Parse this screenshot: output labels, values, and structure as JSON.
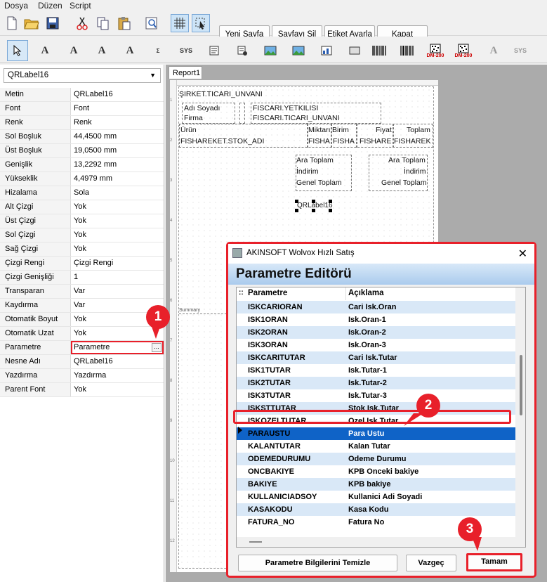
{
  "menu": [
    "Dosya",
    "Düzen",
    "Script"
  ],
  "toolbar": {
    "new_page": "Yeni Sayfa",
    "delete_page": "Sayfayı Sil",
    "label_settings": "Etiket Ayarla",
    "close": "Kapat"
  },
  "tools": {
    "sys1": "SYS",
    "dm1": "DM-200",
    "dm2": "DM-200",
    "sys2": "SYS"
  },
  "component_select": "QRLabel16",
  "properties": [
    {
      "k": "Metin",
      "v": "QRLabel16"
    },
    {
      "k": "Font",
      "v": "Font"
    },
    {
      "k": "Renk",
      "v": "Renk"
    },
    {
      "k": "Sol Boşluk",
      "v": "44,4500 mm"
    },
    {
      "k": "Üst Boşluk",
      "v": "19,0500 mm"
    },
    {
      "k": "Genişlik",
      "v": "13,2292 mm"
    },
    {
      "k": "Yükseklik",
      "v": "4,4979 mm"
    },
    {
      "k": "Hizalama",
      "v": "Sola"
    },
    {
      "k": "Alt Çizgi",
      "v": "Yok"
    },
    {
      "k": "Üst Çizgi",
      "v": "Yok"
    },
    {
      "k": "Sol Çizgi",
      "v": "Yok"
    },
    {
      "k": "Sağ Çizgi",
      "v": "Yok"
    },
    {
      "k": "Çizgi Rengi",
      "v": "Çizgi Rengi"
    },
    {
      "k": "Çizgi Genişliği",
      "v": "1"
    },
    {
      "k": "Transparan",
      "v": "Var"
    },
    {
      "k": "Kaydırma",
      "v": "Var"
    },
    {
      "k": "Otomatik Boyut",
      "v": "Yok"
    },
    {
      "k": "Otomatik Uzat",
      "v": "Yok"
    },
    {
      "k": "Parametre",
      "v": "Parametre"
    },
    {
      "k": "Nesne Adı",
      "v": "QRLabel16"
    },
    {
      "k": "Yazdırma",
      "v": "Yazdırma"
    },
    {
      "k": "Parent Font",
      "v": "Yok"
    }
  ],
  "report": {
    "tab": "Report1",
    "company": "ŞIRKET.TICARI_UNVANI",
    "adi_soyadi": "Adı Soyadı",
    "firma": "Firma",
    "yetkili": "FISCARI.YETKILISI",
    "unvan": "FISCARI.TICARI_UNVANI",
    "col_urun": "Ürün",
    "col_miktar": "Miktarı",
    "col_birim": "Birim",
    "col_fiyat": "Fiyat",
    "col_toplam": "Toplam",
    "d_stok": "FISHAREKET.STOK_ADI",
    "d_miktar": "FISHA",
    "d_birim": "FISHA",
    "d_fiyat": "FISHARE",
    "d_toplam": "FISHAREK",
    "ara_toplam_l": "Ara Toplam",
    "indirim_l": "İndirim",
    "genel_toplam_l": "Genel Toplam",
    "ara_toplam_r": "Ara Toplam",
    "indirim_r": "İndirim",
    "genel_toplam_r": "Genel Toplam",
    "selected_label": "QRLabel16",
    "summary": "Summary",
    "ruler": [
      "1",
      "2",
      "3",
      "4",
      "5",
      "6",
      "7",
      "8",
      "9",
      "10",
      "11",
      "12"
    ]
  },
  "dialog": {
    "window_title": "AKINSOFT Wolvox Hızlı Satış",
    "header": "Parametre Editörü",
    "col_param": "Parametre",
    "col_desc": "Açıklama",
    "rows": [
      {
        "p": "ISKCARIORAN",
        "d": "Cari Isk.Oran"
      },
      {
        "p": "ISK1ORAN",
        "d": "Isk.Oran-1"
      },
      {
        "p": "ISK2ORAN",
        "d": "Isk.Oran-2"
      },
      {
        "p": "ISK3ORAN",
        "d": "Isk.Oran-3"
      },
      {
        "p": "ISKCARITUTAR",
        "d": "Cari Isk.Tutar"
      },
      {
        "p": "ISK1TUTAR",
        "d": "Isk.Tutar-1"
      },
      {
        "p": "ISK2TUTAR",
        "d": "Isk.Tutar-2"
      },
      {
        "p": "ISK3TUTAR",
        "d": "Isk.Tutar-3"
      },
      {
        "p": "ISKSTTUTAR",
        "d": "Stok Isk.Tutar"
      },
      {
        "p": "ISKOZELTUTAR",
        "d": "Ozel Isk.Tutar"
      },
      {
        "p": "PARAUSTU",
        "d": "Para Ustu"
      },
      {
        "p": "KALANTUTAR",
        "d": "Kalan Tutar"
      },
      {
        "p": "ODEMEDURUMU",
        "d": "Odeme Durumu"
      },
      {
        "p": "ONCBAKIYE",
        "d": "KPB Onceki bakiye"
      },
      {
        "p": "BAKIYE",
        "d": "KPB bakiye"
      },
      {
        "p": "KULLANICIADSOY",
        "d": "Kullanici Adi Soyadi"
      },
      {
        "p": "KASAKODU",
        "d": "Kasa Kodu"
      },
      {
        "p": "FATURA_NO",
        "d": "Fatura No"
      }
    ],
    "btn_clear": "Parametre Bilgilerini Temizle",
    "btn_cancel": "Vazgeç",
    "btn_ok": "Tamam"
  },
  "annotations": {
    "step1": "1",
    "step2": "2",
    "step3": "3"
  },
  "colors": {
    "accent": "#e8202a",
    "selected_row": "#0f63c7",
    "alt_row": "#d9e8f7"
  }
}
